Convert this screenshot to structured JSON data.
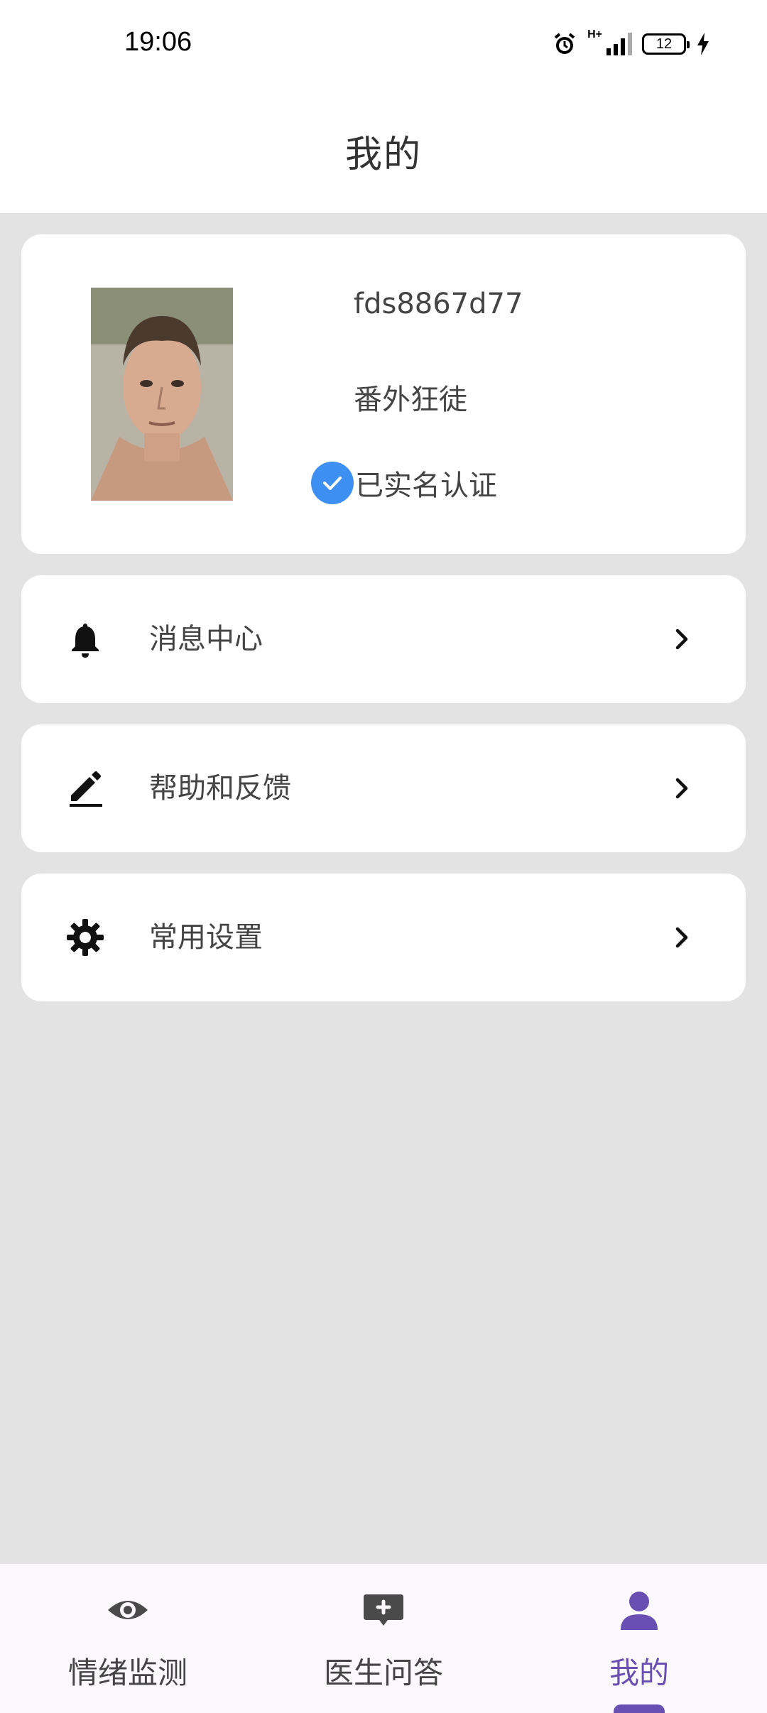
{
  "status": {
    "time": "19:06",
    "battery": "12",
    "network": "H+"
  },
  "header": {
    "title": "我的"
  },
  "profile": {
    "username": "fds8867d77",
    "nickname": "番外狂徒",
    "verified_label": "已实名认证"
  },
  "menu": [
    {
      "label": "消息中心",
      "icon": "bell-icon"
    },
    {
      "label": "帮助和反馈",
      "icon": "pencil-icon"
    },
    {
      "label": "常用设置",
      "icon": "gear-icon"
    }
  ],
  "nav": [
    {
      "label": "情绪监测",
      "icon": "eye-icon",
      "active": false
    },
    {
      "label": "医生问答",
      "icon": "chat-plus-icon",
      "active": false
    },
    {
      "label": "我的",
      "icon": "user-icon",
      "active": true
    }
  ],
  "colors": {
    "accent": "#6a4fb2",
    "verified": "#3e8ff2",
    "background": "#e3e3e3"
  }
}
